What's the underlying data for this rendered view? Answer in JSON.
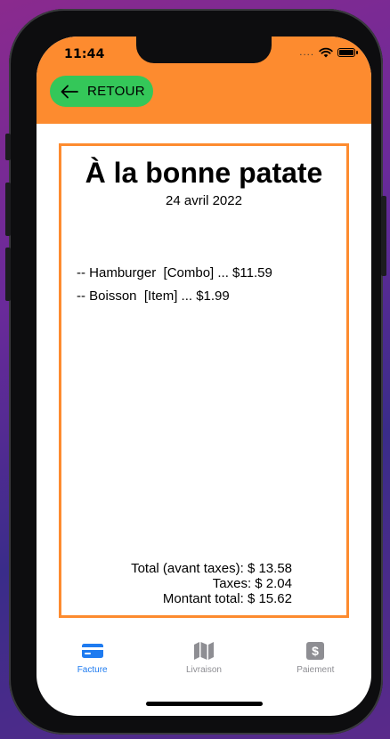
{
  "status_bar": {
    "time": "11:44",
    "signal_dots": "....",
    "icons": [
      "wifi-icon",
      "battery-icon"
    ]
  },
  "header": {
    "back_label": "RETOUR",
    "back_icon": "arrow-left-icon",
    "color": "#fd8b2f",
    "button_color": "#34c759"
  },
  "receipt": {
    "store_name": "À la bonne patate",
    "date": "24 avril 2022",
    "items": [
      {
        "text": "-- Hamburger  [Combo] ... $11.59"
      },
      {
        "text": "-- Boisson  [Item] ... $1.99"
      }
    ],
    "totals": {
      "subtotal": "Total (avant taxes): $ 13.58",
      "taxes": "Taxes: $ 2.04",
      "total": "Montant total: $ 15.62"
    },
    "border_color": "#fd8b2f"
  },
  "tabs": [
    {
      "label": "Facture",
      "icon": "credit-card-icon",
      "active": true
    },
    {
      "label": "Livraison",
      "icon": "map-icon",
      "active": false
    },
    {
      "label": "Paiement",
      "icon": "dollar-icon",
      "active": false
    }
  ],
  "colors": {
    "active_tab": "#1e7bf0",
    "inactive_tab": "#8e8e93"
  }
}
